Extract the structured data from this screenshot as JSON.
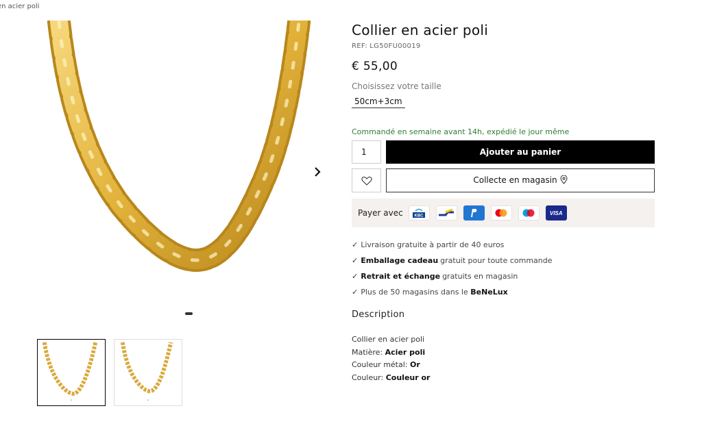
{
  "breadcrumb": "en acier poli",
  "product": {
    "title": "Collier en acier poli",
    "ref": "REF: LG50FU00019",
    "price": "€ 55,00",
    "size_label": "Choisissez votre taille",
    "size_value": "50cm+3cm",
    "notice": "Commandé en semaine avant 14h, expédié le jour même",
    "quantity": "1",
    "add_to_cart": "Ajouter au panier",
    "store_pickup": "Collecte en magasin"
  },
  "payment": {
    "label": "Payer avec",
    "methods": [
      "kbc-icon",
      "bancontact-icon",
      "paypal-icon",
      "mastercard-icon",
      "maestro-icon",
      "visa-icon"
    ],
    "visa_text": "VISA",
    "kbc_text": "KBC"
  },
  "benefits": [
    {
      "pre": "Livraison gratuite à partir de 40 euros",
      "bold": "",
      "post": ""
    },
    {
      "pre": "",
      "bold": "Emballage cadeau",
      "post": "gratuit pour toute commande"
    },
    {
      "pre": "",
      "bold": "Retrait et échange",
      "post": "gratuits en magasin"
    },
    {
      "pre": "Plus de 50 magasins dans le",
      "bold": "BeNeLux",
      "post": ""
    }
  ],
  "description": {
    "heading": "Description",
    "line1": "Collier en acier poli",
    "material_label": "Matière:",
    "material_value": "Acier poli",
    "metal_label": "Couleur métal:",
    "metal_value": "Or",
    "color_label": "Couleur:",
    "color_value": "Couleur or"
  },
  "colors": {
    "gold": "#e2b23a",
    "gold_dark": "#b8871c",
    "notice_green": "#2e7d32",
    "button_black": "#000000",
    "payment_bg": "#f4f1ee"
  }
}
